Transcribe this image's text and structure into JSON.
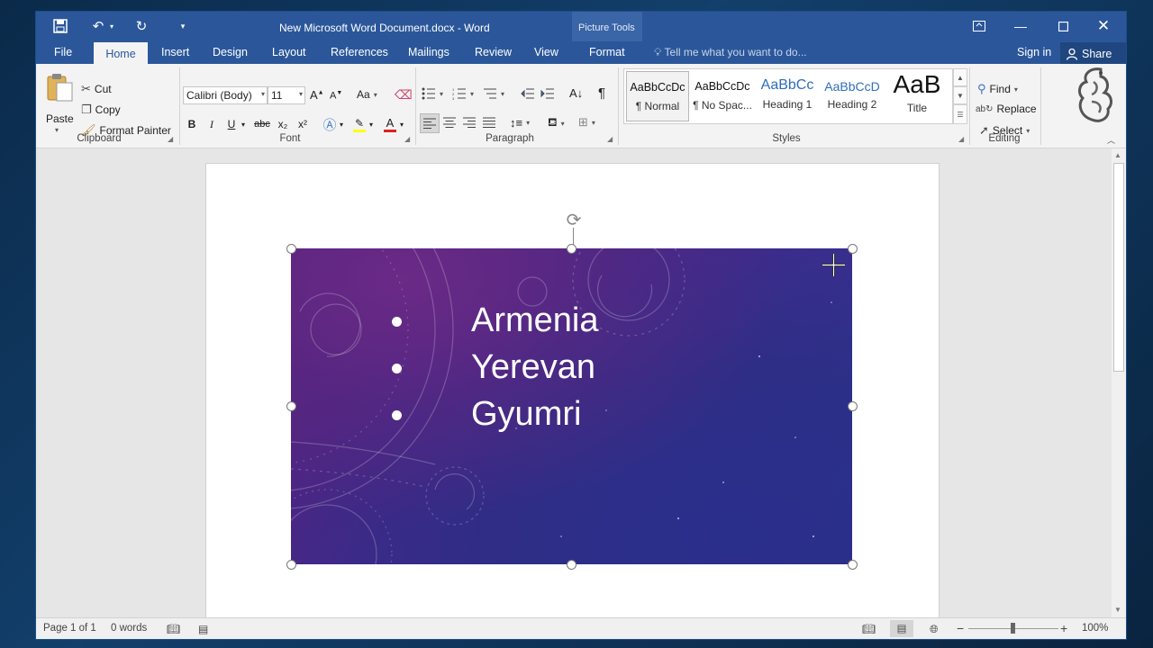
{
  "title_bar": {
    "document_title": "New Microsoft Word Document.docx - Word",
    "contextual_group": "Picture Tools",
    "icons": [
      "save-icon",
      "undo-icon",
      "redo-icon",
      "customize-qat-icon",
      "ribbon-display-options-icon",
      "minimize-icon",
      "maximize-icon",
      "close-icon"
    ]
  },
  "tabs": {
    "file": "File",
    "home": "Home",
    "insert": "Insert",
    "design": "Design",
    "layout": "Layout",
    "references": "References",
    "mailings": "Mailings",
    "review": "Review",
    "view": "View",
    "format": "Format",
    "tell_me": "Tell me what you want to do...",
    "sign_in": "Sign in",
    "share": "Share"
  },
  "clipboard": {
    "paste": "Paste",
    "cut": "Cut",
    "copy": "Copy",
    "format_painter": "Format Painter",
    "label": "Clipboard"
  },
  "font": {
    "font_name": "Calibri (Body)",
    "font_size": "11",
    "change_case": "Aa",
    "bold": "B",
    "italic": "I",
    "underline": "U",
    "strikethrough": "abc",
    "subscript": "x₂",
    "superscript": "x²",
    "label": "Font"
  },
  "paragraph": {
    "label": "Paragraph"
  },
  "styles": {
    "items": [
      {
        "sample": "AaBbCcDc",
        "name": "¶ Normal"
      },
      {
        "sample": "AaBbCcDc",
        "name": "¶ No Spac..."
      },
      {
        "sample": "AaBbCc",
        "name": "Heading 1"
      },
      {
        "sample": "AaBbCcD",
        "name": "Heading 2"
      },
      {
        "sample": "AaB",
        "name": "Title"
      }
    ],
    "label": "Styles"
  },
  "editing": {
    "find": "Find",
    "replace": "Replace",
    "select": "Select",
    "label": "Editing"
  },
  "slide_image": {
    "bullets": [
      "Armenia",
      "Yerevan",
      "Gyumri"
    ]
  },
  "status_bar": {
    "page": "Page 1 of 1",
    "words": "0 words",
    "zoom": "100%"
  },
  "colors": {
    "word_blue": "#2b579a",
    "ribbon_bg": "#f3f3f3",
    "highlight_yellow": "#ffff00",
    "font_color_red": "#e02020"
  }
}
